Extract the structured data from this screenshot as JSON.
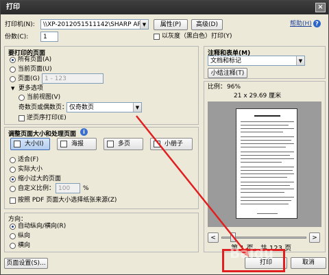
{
  "window": {
    "title": "打印",
    "close_glyph": "×"
  },
  "top": {
    "printer_label": "打印机(N):",
    "printer_value": "\\\\XP-2012051511142\\SHARP AR-1808S",
    "properties_button": "属性(P)",
    "advanced_button": "高级(D)",
    "help_link": "帮助(H)",
    "copies_label": "份数(C):",
    "copies_value": "1",
    "grayscale_label": "以灰度（黑白色）打印(Y)"
  },
  "pages_group": {
    "title": "要打印的页面",
    "all_pages": "所有页面(A)",
    "current_page": "当前页面(U)",
    "pages": "页面(G)",
    "pages_value": "1 - 123",
    "more_options": "更多选项",
    "current_view": "当前视图(V)",
    "odd_even_label": "奇数页或偶数页：",
    "odd_even_value": "仅奇数页",
    "reverse_label": "逆页序打印(E)"
  },
  "size_group": {
    "title": "调整页面大小和处理页面",
    "tools": [
      "大小(I)",
      "海报",
      "多页",
      "小册子"
    ],
    "fit": "适合(F)",
    "actual_size": "实际大小",
    "shrink_oversized": "缩小过大的页面",
    "custom_scale_label": "自定义比例：",
    "custom_scale_value": "100",
    "percent": "%",
    "pdf_paper_label": "按照 PDF 页面大小选择纸张来源(Z)"
  },
  "orientation_group": {
    "title": "方向：",
    "auto": "自动纵向/横向(R)",
    "portrait": "纵向",
    "landscape": "横向"
  },
  "comments_group": {
    "title": "注释和表单(M)",
    "value": "文档和标记",
    "summarize_button": "小结注释(T)"
  },
  "preview": {
    "scale_label": "比例：",
    "scale_value": "96%",
    "dimensions": "21 x 29.69 厘米",
    "page_counter": "第 1 页，共 123 页",
    "prev_glyph": "<",
    "next_glyph": ">"
  },
  "bottom": {
    "page_setup_button": "页面设置(S)...",
    "print_button": "打印",
    "cancel_button": "取消"
  },
  "overlay": {
    "watermark": "Baidu",
    "annotation_color": "#e02020"
  }
}
